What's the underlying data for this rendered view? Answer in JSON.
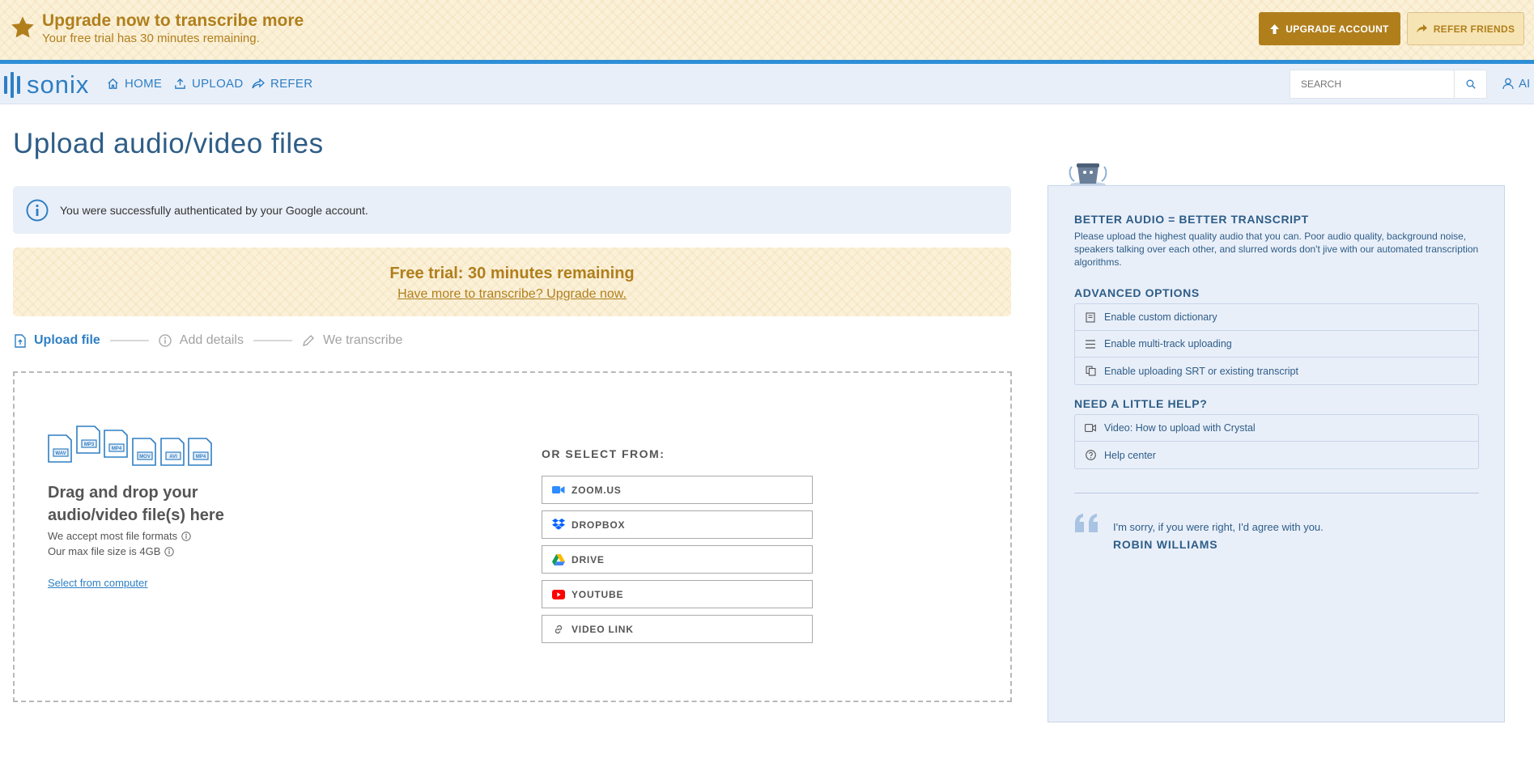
{
  "banner": {
    "title": "Upgrade now to transcribe more",
    "subtitle": "Your free trial has 30 minutes remaining.",
    "upgrade_label": "UPGRADE ACCOUNT",
    "refer_label": "REFER FRIENDS"
  },
  "nav": {
    "logo_text": "sonix",
    "items": [
      {
        "label": "HOME",
        "icon": "home-icon"
      },
      {
        "label": "UPLOAD",
        "icon": "upload-icon"
      },
      {
        "label": "REFER",
        "icon": "share-icon"
      }
    ],
    "search_placeholder": "SEARCH",
    "user_label": "AI"
  },
  "main": {
    "title": "Upload audio/video files",
    "info_message": "You were successfully authenticated by your Google account.",
    "trial_title": "Free trial: 30 minutes remaining",
    "trial_link": "Have more to transcribe? Upgrade now.",
    "steps": [
      {
        "label": "Upload file",
        "active": true
      },
      {
        "label": "Add details",
        "active": false
      },
      {
        "label": "We transcribe",
        "active": false
      }
    ],
    "file_types": [
      "WAV",
      "MP3",
      "MP4",
      "MOV",
      "AVI",
      "MP4"
    ],
    "drag_title": "Drag and drop your audio/video file(s) here",
    "accept_text": "We accept most file formats",
    "max_size_text": "Our max file size is 4GB",
    "select_computer": "Select from computer",
    "or_select": "OR SELECT FROM:",
    "sources": [
      {
        "label": "ZOOM.US",
        "icon": "zoom-icon"
      },
      {
        "label": "DROPBOX",
        "icon": "dropbox-icon"
      },
      {
        "label": "DRIVE",
        "icon": "google-drive-icon"
      },
      {
        "label": "YOUTUBE",
        "icon": "youtube-icon"
      },
      {
        "label": "VIDEO LINK",
        "icon": "link-icon"
      }
    ]
  },
  "panel": {
    "better_title": "BETTER AUDIO = BETTER TRANSCRIPT",
    "better_text": "Please upload the highest quality audio that you can. Poor audio quality, background noise, speakers talking over each other, and slurred words don't jive with our automated transcription algorithms.",
    "advanced_title": "ADVANCED OPTIONS",
    "advanced": [
      {
        "label": "Enable custom dictionary",
        "icon": "book-icon"
      },
      {
        "label": "Enable multi-track uploading",
        "icon": "list-icon"
      },
      {
        "label": "Enable uploading SRT or existing transcript",
        "icon": "copy-icon"
      }
    ],
    "help_title": "NEED A LITTLE HELP?",
    "help": [
      {
        "label": "Video: How to upload with Crystal",
        "icon": "video-icon"
      },
      {
        "label": "Help center",
        "icon": "question-icon"
      }
    ],
    "quote": "I'm sorry, if you were right, I'd agree with you.",
    "quote_author": "ROBIN WILLIAMS"
  },
  "colors": {
    "brand_blue": "#2e7fc4",
    "gold": "#b07f1c",
    "panel_bg": "#e9eff9"
  }
}
